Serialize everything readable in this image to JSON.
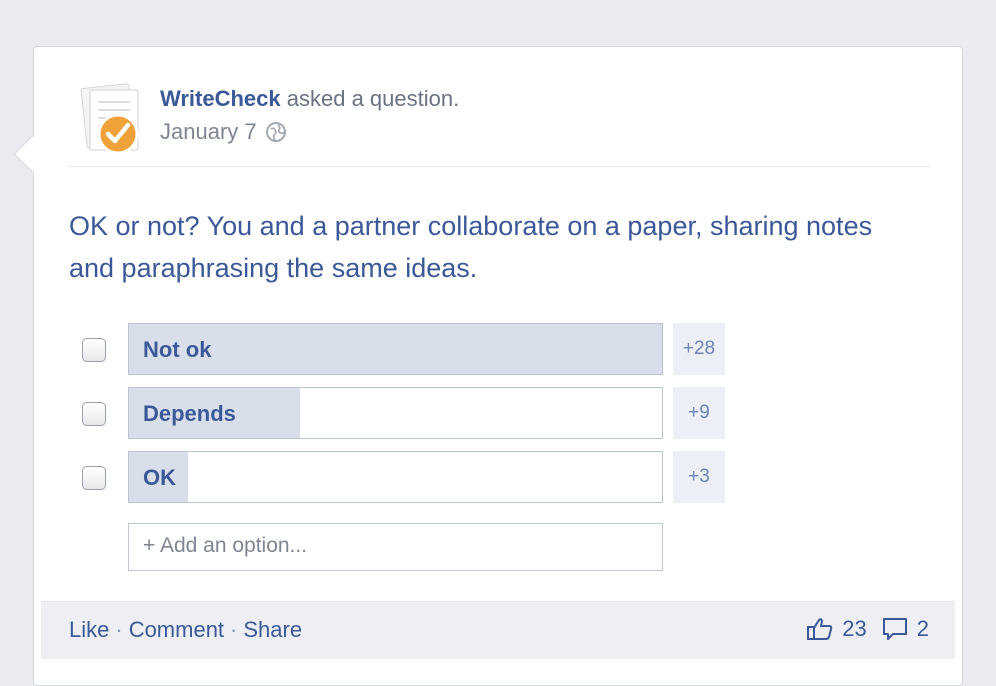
{
  "post": {
    "author": "WriteCheck",
    "action_text": "asked a question.",
    "date": "January 7",
    "icons": {
      "avatar": "writecheck-logo",
      "privacy": "globe-icon"
    }
  },
  "question": {
    "text": "OK or not? You and a partner collaborate on a paper, sharing notes and paraphrasing the same ideas."
  },
  "poll": {
    "options": [
      {
        "label": "Not ok",
        "count_label": "+28",
        "fill_fraction": 1.0
      },
      {
        "label": "Depends",
        "count_label": "+9",
        "fill_fraction": 0.32
      },
      {
        "label": "OK",
        "count_label": "+3",
        "fill_fraction": 0.11
      }
    ],
    "add_option_placeholder": "+ Add an option..."
  },
  "footer": {
    "like": "Like",
    "separator": "·",
    "comment": "Comment",
    "share": "Share",
    "likes_count": "23",
    "comments_count": "2",
    "icons": {
      "likes": "thumbs-up-icon",
      "comments": "comment-bubble-icon"
    }
  },
  "colors": {
    "link_blue": "#3b5998",
    "poll_fill": "#d8dfea",
    "count_bg": "#eceff5",
    "footer_bg": "#edeff4",
    "page_bg": "#e9ebee"
  }
}
